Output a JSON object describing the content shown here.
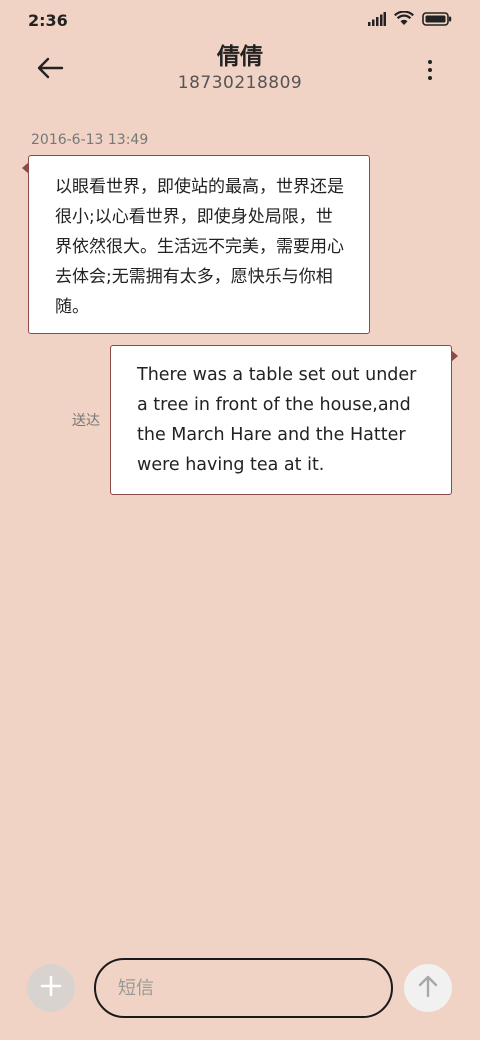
{
  "status_bar": {
    "time": "2:36",
    "icons": [
      "signal-icon",
      "wifi-icon",
      "battery-icon"
    ]
  },
  "header": {
    "back_icon": "back-arrow-icon",
    "contact_name": "倩倩",
    "contact_number": "18730218809",
    "more_icon": "more-vertical-icon"
  },
  "conversation": {
    "timestamp": "2016-6-13 13:49",
    "messages": [
      {
        "direction": "incoming",
        "text": "以眼看世界，即使站的最高，世界还是很小;以心看世界，即使身处局限，世界依然很大。生活远不完美，需要用心去体会;无需拥有太多，愿快乐与你相随。"
      },
      {
        "direction": "outgoing",
        "text": "There was a table set out under a tree in front of the house,and the March Hare and the Hatter were having tea at it.",
        "status": "送达"
      }
    ]
  },
  "composer": {
    "add_icon": "plus-icon",
    "placeholder": "短信",
    "value": "",
    "send_icon": "send-arrow-up-icon"
  },
  "colors": {
    "background": "#f1d3c5",
    "bubble_border": "#8a4a4a",
    "bubble_fill": "#ffffff"
  }
}
